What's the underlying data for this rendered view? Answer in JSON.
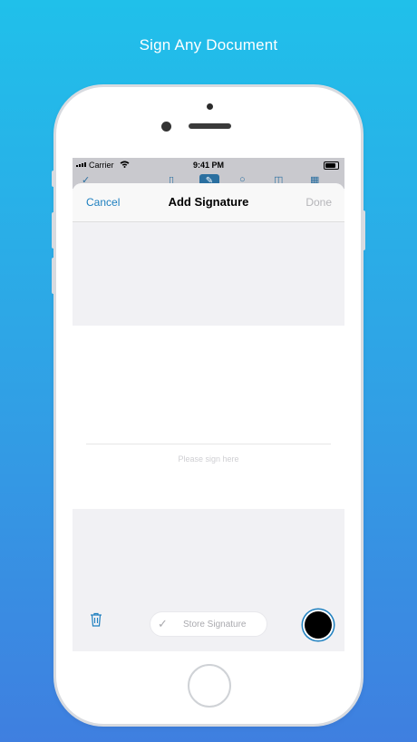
{
  "headline": "Sign Any Document",
  "status_bar": {
    "carrier": "Carrier",
    "time": "9:41 PM"
  },
  "background_toolbar": {
    "icons": [
      "checkmark-icon",
      "page-icon",
      "pencil-icon",
      "search-icon",
      "book-icon",
      "grid-icon"
    ]
  },
  "sheet": {
    "cancel_label": "Cancel",
    "title": "Add Signature",
    "done_label": "Done"
  },
  "signature_pad": {
    "hint": "Please sign here"
  },
  "bottom_bar": {
    "store_label": "Store Signature",
    "trash_icon": "trash-icon",
    "pen_color": "#000000"
  },
  "colors": {
    "accent": "#1d7fbf",
    "gradient_top": "#20c0ea",
    "gradient_bottom": "#3f7fe0"
  }
}
